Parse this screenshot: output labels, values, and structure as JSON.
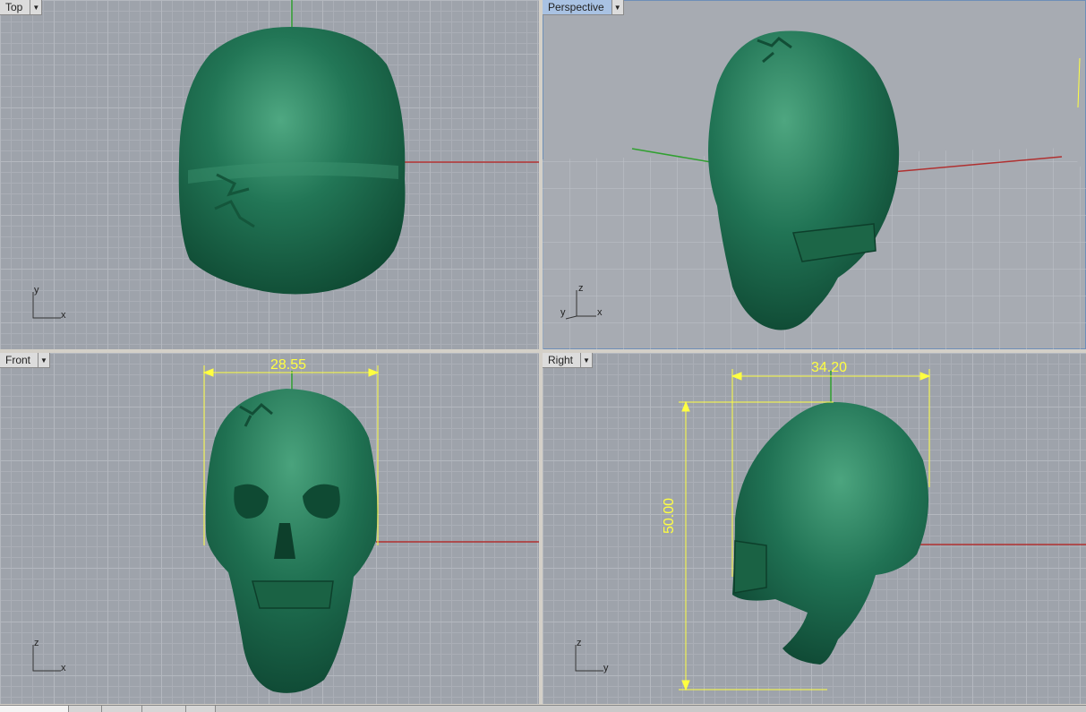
{
  "viewports": {
    "top": {
      "label": "Top"
    },
    "perspective": {
      "label": "Perspective"
    },
    "front": {
      "label": "Front"
    },
    "right": {
      "label": "Right"
    }
  },
  "axes": {
    "x": "x",
    "y": "y",
    "z": "z"
  },
  "dimensions": {
    "front_width": "28.55",
    "right_width": "34.20",
    "right_height": "50.00"
  },
  "colors": {
    "model": "#1f7350",
    "dimension": "#ffff40",
    "x_axis": "#b03030",
    "y_axis": "#30a030",
    "active_label": "#a9c2e3"
  },
  "icons": {
    "dropdown": "dropdown-arrow-icon"
  }
}
